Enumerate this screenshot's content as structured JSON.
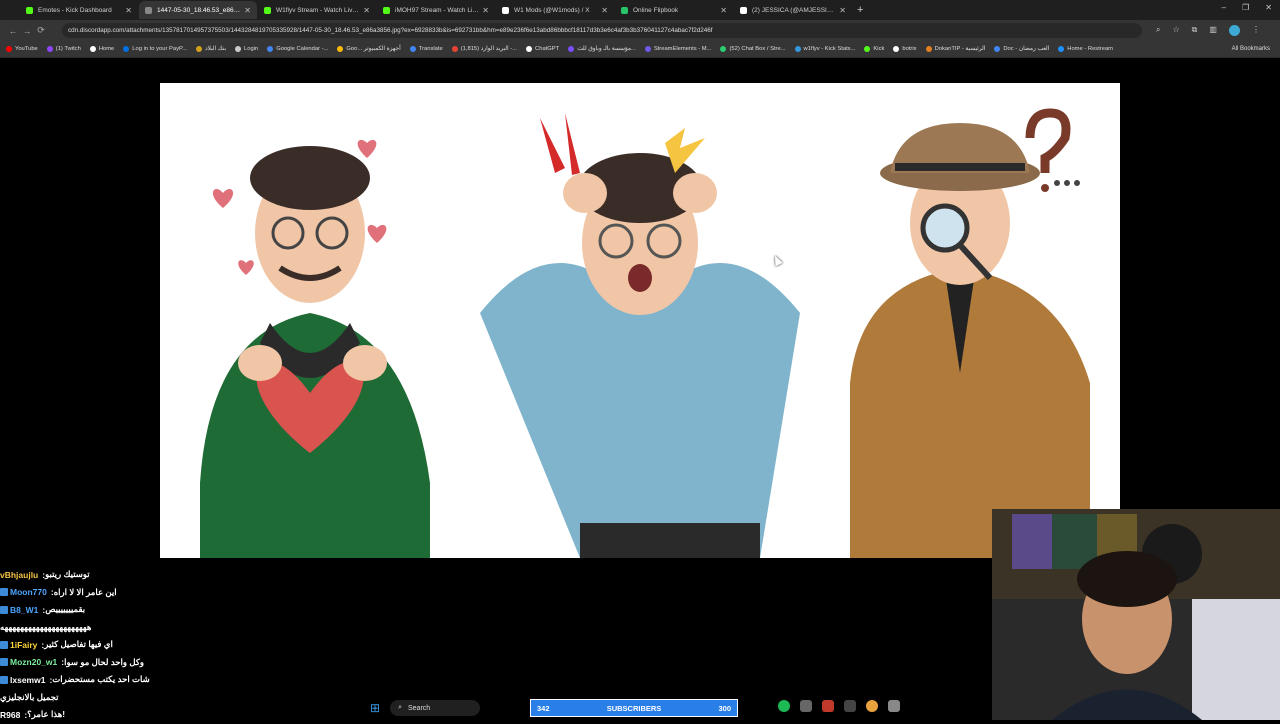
{
  "browser": {
    "tabs": [
      {
        "title": "Emotes - Kick Dashboard",
        "color": "#53fc18",
        "active": false
      },
      {
        "title": "1447-05-30_18.46.53_e86a3856...",
        "color": "#888888",
        "active": true
      },
      {
        "title": "W1flyv Stream - Watch Live on ...",
        "color": "#53fc18",
        "active": false
      },
      {
        "title": "iMOH97 Stream - Watch Live o...",
        "color": "#53fc18",
        "active": false
      },
      {
        "title": "W1 Mods (@W1mods) / X",
        "color": "#ffffff",
        "active": false
      },
      {
        "title": "Online Flipbook",
        "color": "#29c46a",
        "active": false
      },
      {
        "title": "(2) JESSICA (@AMJESSICA1_) /",
        "color": "#ffffff",
        "active": false
      }
    ],
    "new_tab": "+",
    "window_controls": [
      "–",
      "❐",
      "✕"
    ],
    "nav_buttons": [
      "←",
      "→",
      "⟳"
    ],
    "url": "cdn.discordapp.com/attachments/1357817014957375503/1443284819705335928/1447-05-30_18.46.53_e86a3856.jpg?ex=6928833b&is=692731bb&hm=e89e236f6e13abd86bbbcf18117d3b3e6c4af3b3b376041127c4abac7f2d246f",
    "bookmarks": [
      {
        "label": "YouTube",
        "color": "#ff0000"
      },
      {
        "label": "(1) Twitch",
        "color": "#9146ff"
      },
      {
        "label": "Home",
        "color": "#ffffff"
      },
      {
        "label": "Log in to your PayP...",
        "color": "#0070e0"
      },
      {
        "label": "بنك البلاد",
        "color": "#d4a017"
      },
      {
        "label": "Login",
        "color": "#cccccc"
      },
      {
        "label": "Google Calendar -...",
        "color": "#4285f4"
      },
      {
        "label": "Goo... أجهزة الكمبيوتر",
        "color": "#fbbc05"
      },
      {
        "label": "Translate",
        "color": "#4285f4"
      },
      {
        "label": "(1,815) البريد الوارد -...",
        "color": "#ea4335"
      },
      {
        "label": "ChatGPT",
        "color": "#ffffff"
      },
      {
        "label": "مؤسسة بالـ وباوق للث...",
        "color": "#7c4dff"
      },
      {
        "label": "StreamElements - M...",
        "color": "#6c5ce7"
      },
      {
        "label": "(52) Chat Box / Stre...",
        "color": "#2ecc71"
      },
      {
        "label": "w1flyv - Kick Stats...",
        "color": "#3498db"
      },
      {
        "label": "Kick",
        "color": "#53fc18"
      },
      {
        "label": "botrix",
        "color": "#ffffff"
      },
      {
        "label": "DokanTIP - الرئيسية",
        "color": "#e67e22"
      },
      {
        "label": "Doc - العب رمضان",
        "color": "#4285f4"
      },
      {
        "label": "Home - Restream",
        "color": "#1e90ff"
      }
    ],
    "all_bookmarks": "All Bookmarks"
  },
  "chat": {
    "messages": [
      {
        "user": "vBhjaujlu",
        "user_color": "#f5c542",
        "message": "توستيك ريتبو",
        "has_badge": false
      },
      {
        "user": "Moon770",
        "user_color": "#4da6ff",
        "message": "اين عامر الا لا اراه",
        "has_badge": true
      },
      {
        "user": "B8_W1",
        "user_color": "#4da6ff",
        "message": "بقميييييييص",
        "has_badge": true
      },
      {
        "user": "",
        "user_color": "#ffffff",
        "message": "ههههههههههههههههههههههه",
        "has_badge": false
      },
      {
        "user": "1iFairy",
        "user_color": "#ffd93d",
        "message": "اي فيها تفاصيل كثير",
        "has_badge": true
      },
      {
        "user": "Mozn20_w1",
        "user_color": "#7bed9f",
        "message": "وكل واحد لحال مو سوا",
        "has_badge": true
      },
      {
        "user": "lxsemw1",
        "user_color": "#ffffff",
        "message": "شات احد يكتب مستحضرات",
        "has_badge": true
      },
      {
        "user": "",
        "user_color": "#ffffff",
        "message": "تجميل بالانجليزي",
        "has_badge": false
      },
      {
        "user": "R968",
        "user_color": "#ffffff",
        "message": "هذا عامر؟!",
        "has_badge": false
      }
    ]
  },
  "taskbar": {
    "search_label": "Search",
    "subscribers": {
      "current": "342",
      "label": "SUBSCRIBERS",
      "goal": "300",
      "progress": 1.0
    }
  }
}
